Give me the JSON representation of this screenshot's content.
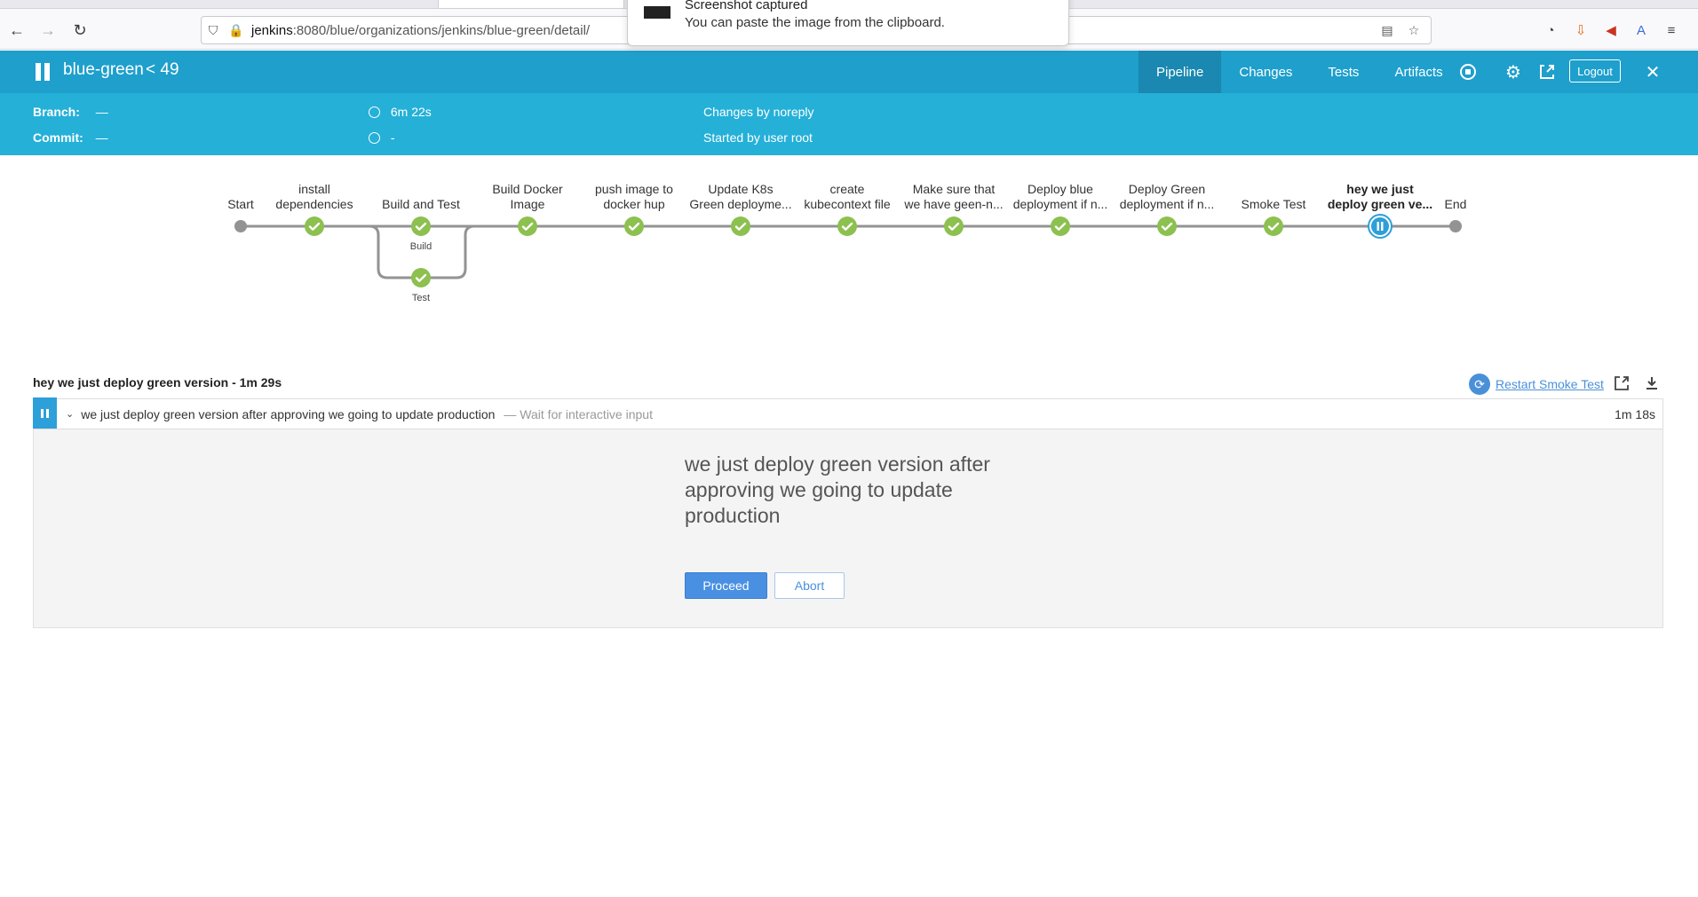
{
  "browser": {
    "url_host": "jenkins",
    "url_path": ":8080/blue/organizations/jenkins/blue-green/detail/"
  },
  "notification": {
    "title": "Screenshot captured",
    "message": "You can paste the image from the clipboard."
  },
  "header": {
    "job_name": "blue-green",
    "run_number": "49",
    "tabs": [
      {
        "label": "Pipeline",
        "active": true
      },
      {
        "label": "Changes",
        "active": false
      },
      {
        "label": "Tests",
        "active": false
      },
      {
        "label": "Artifacts",
        "active": false
      }
    ],
    "logout_label": "Logout",
    "accent": "#1e9fcc"
  },
  "run_info": {
    "branch_label": "Branch:",
    "branch_value": "—",
    "commit_label": "Commit:",
    "commit_value": "—",
    "duration": "6m 22s",
    "time": "-",
    "changes": "Changes by noreply",
    "started": "Started by user root"
  },
  "pipeline": {
    "stages": [
      {
        "line1": "",
        "line2": "Start",
        "status": "start"
      },
      {
        "line1": "install",
        "line2": "dependencies",
        "status": "success"
      },
      {
        "line1": "",
        "line2": "Build and Test",
        "status": "success",
        "parallel": [
          "Build",
          "Test"
        ]
      },
      {
        "line1": "Build Docker",
        "line2": "Image",
        "status": "success"
      },
      {
        "line1": "push image to",
        "line2": "docker hup",
        "status": "success"
      },
      {
        "line1": "Update K8s",
        "line2": "Green deployme...",
        "status": "success"
      },
      {
        "line1": "create",
        "line2": "kubecontext file",
        "status": "success"
      },
      {
        "line1": "Make sure that",
        "line2": "we have geen-n...",
        "status": "success"
      },
      {
        "line1": "Deploy blue",
        "line2": "deployment if n...",
        "status": "success"
      },
      {
        "line1": "Deploy Green",
        "line2": "deployment if n...",
        "status": "success"
      },
      {
        "line1": "",
        "line2": "Smoke Test",
        "status": "success"
      },
      {
        "line1": "hey we just",
        "line2": "deploy green ve...",
        "status": "paused",
        "selected": true
      },
      {
        "line1": "",
        "line2": "End",
        "status": "end"
      }
    ],
    "success_color": "#8cc04f",
    "paused_color": "#2d9fd9"
  },
  "step_panel": {
    "title": "hey we just deploy green version - 1m 29s",
    "restart_label": "Restart Smoke Test",
    "step_name": "we just deploy green version after approving we going to update production",
    "step_subtitle": "— Wait for interactive input",
    "step_duration": "1m 18s",
    "input_message": "we just deploy green version after approving we going to update production",
    "proceed_label": "Proceed",
    "abort_label": "Abort"
  }
}
